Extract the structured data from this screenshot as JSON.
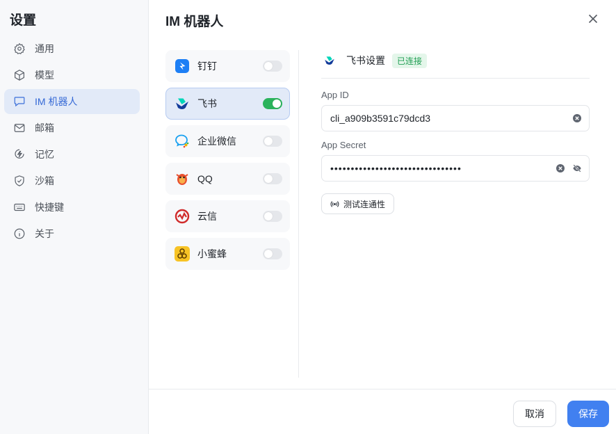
{
  "sidebar": {
    "title": "设置",
    "items": [
      {
        "label": "通用",
        "icon": "gear-icon",
        "active": false
      },
      {
        "label": "模型",
        "icon": "cube-icon",
        "active": false
      },
      {
        "label": "IM 机器人",
        "icon": "chat-bubble-icon",
        "active": true
      },
      {
        "label": "邮箱",
        "icon": "mail-icon",
        "active": false
      },
      {
        "label": "记忆",
        "icon": "memory-bolt-icon",
        "active": false
      },
      {
        "label": "沙箱",
        "icon": "shield-check-icon",
        "active": false
      },
      {
        "label": "快捷键",
        "icon": "keyboard-icon",
        "active": false
      },
      {
        "label": "关于",
        "icon": "info-icon",
        "active": false
      }
    ]
  },
  "main": {
    "title": "IM 机器人"
  },
  "bots": [
    {
      "name": "钉钉",
      "logo": "dingtalk-logo-icon",
      "enabled": false,
      "selected": false
    },
    {
      "name": "飞书",
      "logo": "feishu-logo-icon",
      "enabled": true,
      "selected": true
    },
    {
      "name": "企业微信",
      "logo": "wecom-logo-icon",
      "enabled": false,
      "selected": false
    },
    {
      "name": "QQ",
      "logo": "qq-logo-icon",
      "enabled": false,
      "selected": false
    },
    {
      "name": "云信",
      "logo": "yunxin-logo-icon",
      "enabled": false,
      "selected": false
    },
    {
      "name": "小蜜蜂",
      "logo": "bee-logo-icon",
      "enabled": false,
      "selected": false
    }
  ],
  "panel": {
    "title": "飞书设置",
    "status": "已连接",
    "app_id_label": "App ID",
    "app_id_value": "cli_a909b3591c79dcd3",
    "app_secret_label": "App Secret",
    "app_secret_value": "••••••••••••••••••••••••••••••••",
    "test_button": "测试连通性"
  },
  "footer": {
    "cancel": "取消",
    "save": "保存"
  },
  "colors": {
    "accent": "#4180f0",
    "active_bg": "#e2eaf8",
    "toggle_on": "#2bb35c",
    "status_green": "#1f9e52"
  }
}
